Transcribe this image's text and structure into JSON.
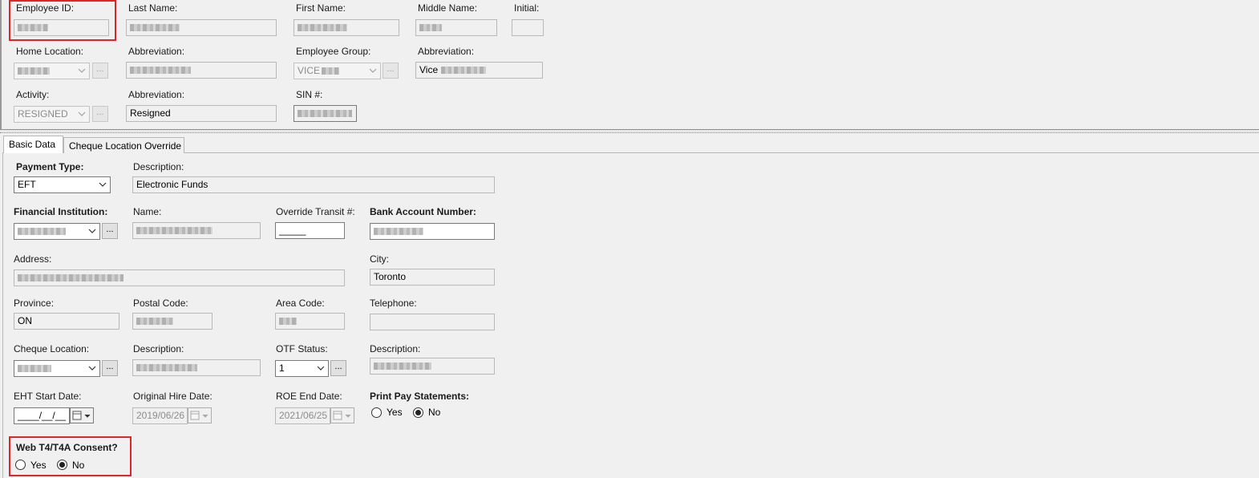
{
  "header": {
    "employee_id": {
      "label": "Employee ID:"
    },
    "last_name": {
      "label": "Last Name:"
    },
    "first_name": {
      "label": "First Name:"
    },
    "middle_name": {
      "label": "Middle Name:"
    },
    "initial": {
      "label": "Initial:"
    },
    "home_location": {
      "label": "Home Location:",
      "button": "..."
    },
    "home_abbreviation": {
      "label": "Abbreviation:"
    },
    "employee_group": {
      "label": "Employee Group:",
      "value": "VICE",
      "button": "..."
    },
    "group_abbreviation": {
      "label": "Abbreviation:",
      "value": "Vice"
    },
    "activity": {
      "label": "Activity:",
      "value": "RESIGNED",
      "button": "..."
    },
    "activity_abbreviation": {
      "label": "Abbreviation:",
      "value": "Resigned"
    },
    "sin": {
      "label": "SIN #:"
    }
  },
  "tabs": [
    {
      "label": "Basic Data",
      "active": true
    },
    {
      "label": "Cheque Location Override",
      "active": false
    }
  ],
  "basic": {
    "payment_type": {
      "label": "Payment Type:",
      "value": "EFT"
    },
    "payment_description": {
      "label": "Description:",
      "value": "Electronic Funds"
    },
    "financial_institution": {
      "label": "Financial Institution:",
      "button": "..."
    },
    "fi_name": {
      "label": "Name:"
    },
    "override_transit": {
      "label": "Override Transit #:",
      "value": "_____"
    },
    "bank_account": {
      "label": "Bank Account Number:"
    },
    "address": {
      "label": "Address:"
    },
    "city": {
      "label": "City:",
      "value": "Toronto"
    },
    "province": {
      "label": "Province:",
      "value": "ON"
    },
    "postal_code": {
      "label": "Postal Code:"
    },
    "area_code": {
      "label": "Area Code:"
    },
    "telephone": {
      "label": "Telephone:",
      "value": ""
    },
    "cheque_location": {
      "label": "Cheque Location:",
      "button": "..."
    },
    "cheque_description": {
      "label": "Description:"
    },
    "otf_status": {
      "label": "OTF Status:",
      "value": "1",
      "button": "..."
    },
    "otf_description": {
      "label": "Description:"
    },
    "eht_start_date": {
      "label": "EHT Start Date:",
      "value": "____/__/__"
    },
    "original_hire_date": {
      "label": "Original Hire Date:",
      "value": "2019/06/26"
    },
    "roe_end_date": {
      "label": "ROE End Date:",
      "value": "2021/06/25"
    },
    "print_pay_statements": {
      "label": "Print Pay Statements:",
      "yes": "Yes",
      "no": "No",
      "selected": "No"
    },
    "web_t4_consent": {
      "label": "Web T4/T4A Consent?",
      "yes": "Yes",
      "no": "No",
      "selected": "No"
    }
  },
  "colors": {
    "highlight": "#e0242b",
    "field_bg": "#f0f0f0",
    "window_bg": "#f0f0f0"
  }
}
